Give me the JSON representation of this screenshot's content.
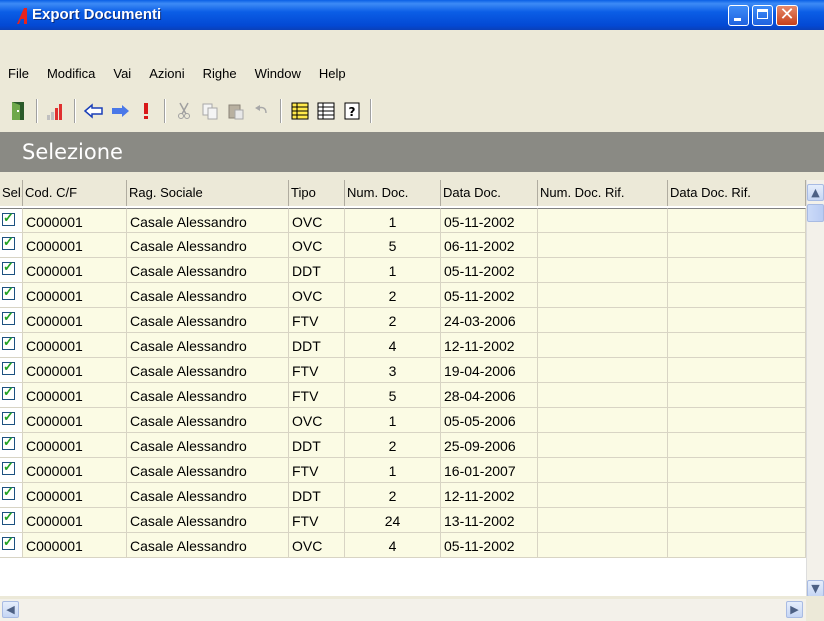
{
  "window": {
    "title": "Export Documenti",
    "buttons": {
      "minimize": "minimize-icon",
      "maximize": "maximize-icon",
      "close": "✕"
    }
  },
  "menu": [
    "File",
    "Modifica",
    "Vai",
    "Azioni",
    "Righe",
    "Window",
    "Help"
  ],
  "toolbar": {
    "icons": [
      "exit-door-icon",
      "signal-bars-icon",
      "arrow-left-icon",
      "arrow-right-icon",
      "exclamation-icon",
      "cut-icon",
      "copy-icon",
      "paste-icon",
      "undo-icon",
      "list-detail-icon",
      "list-icon",
      "help-icon"
    ]
  },
  "section": {
    "title": "Selezione"
  },
  "grid": {
    "columns": [
      "Sel.",
      "Cod. C/F",
      "Rag. Sociale",
      "Tipo",
      "Num. Doc.",
      "Data Doc.",
      "Num. Doc. Rif.",
      "Data Doc. Rif."
    ],
    "rows": [
      {
        "sel": true,
        "cod": "C000001",
        "rag": "Casale Alessandro",
        "tipo": "OVC",
        "num": "1",
        "data": "05-11-2002",
        "numrif": "",
        "datarif": ""
      },
      {
        "sel": true,
        "cod": "C000001",
        "rag": "Casale Alessandro",
        "tipo": "OVC",
        "num": "5",
        "data": "06-11-2002",
        "numrif": "",
        "datarif": ""
      },
      {
        "sel": true,
        "cod": "C000001",
        "rag": "Casale Alessandro",
        "tipo": "DDT",
        "num": "1",
        "data": "05-11-2002",
        "numrif": "",
        "datarif": ""
      },
      {
        "sel": true,
        "cod": "C000001",
        "rag": "Casale Alessandro",
        "tipo": "OVC",
        "num": "2",
        "data": "05-11-2002",
        "numrif": "",
        "datarif": ""
      },
      {
        "sel": true,
        "cod": "C000001",
        "rag": "Casale Alessandro",
        "tipo": "FTV",
        "num": "2",
        "data": "24-03-2006",
        "numrif": "",
        "datarif": ""
      },
      {
        "sel": true,
        "cod": "C000001",
        "rag": "Casale Alessandro",
        "tipo": "DDT",
        "num": "4",
        "data": "12-11-2002",
        "numrif": "",
        "datarif": ""
      },
      {
        "sel": true,
        "cod": "C000001",
        "rag": "Casale Alessandro",
        "tipo": "FTV",
        "num": "3",
        "data": "19-04-2006",
        "numrif": "",
        "datarif": ""
      },
      {
        "sel": true,
        "cod": "C000001",
        "rag": "Casale Alessandro",
        "tipo": "FTV",
        "num": "5",
        "data": "28-04-2006",
        "numrif": "",
        "datarif": ""
      },
      {
        "sel": true,
        "cod": "C000001",
        "rag": "Casale Alessandro",
        "tipo": "OVC",
        "num": "1",
        "data": "05-05-2006",
        "numrif": "",
        "datarif": ""
      },
      {
        "sel": true,
        "cod": "C000001",
        "rag": "Casale Alessandro",
        "tipo": "DDT",
        "num": "2",
        "data": "25-09-2006",
        "numrif": "",
        "datarif": ""
      },
      {
        "sel": true,
        "cod": "C000001",
        "rag": "Casale Alessandro",
        "tipo": "FTV",
        "num": "1",
        "data": "16-01-2007",
        "numrif": "",
        "datarif": ""
      },
      {
        "sel": true,
        "cod": "C000001",
        "rag": "Casale Alessandro",
        "tipo": "DDT",
        "num": "2",
        "data": "12-11-2002",
        "numrif": "",
        "datarif": ""
      },
      {
        "sel": true,
        "cod": "C000001",
        "rag": "Casale Alessandro",
        "tipo": "FTV",
        "num": "24",
        "data": "13-11-2002",
        "numrif": "",
        "datarif": ""
      },
      {
        "sel": true,
        "cod": "C000001",
        "rag": "Casale Alessandro",
        "tipo": "OVC",
        "num": "4",
        "data": "05-11-2002",
        "numrif": "",
        "datarif": ""
      }
    ]
  },
  "colors": {
    "title_bar": "#0b5ee6",
    "header_band": "#8a8a84",
    "row_bg": "#fbfbe4",
    "check": "#21a121"
  }
}
